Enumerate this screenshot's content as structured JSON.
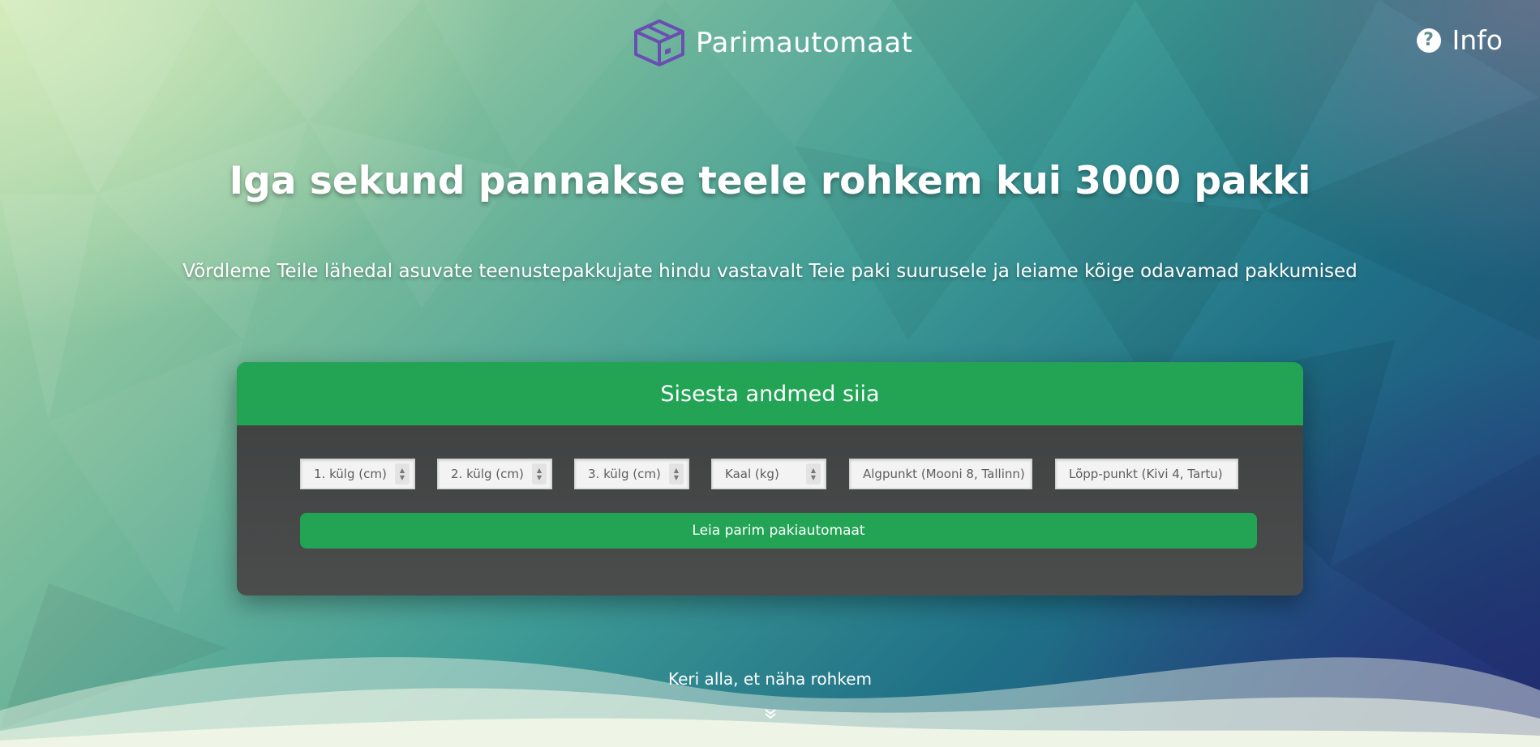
{
  "header": {
    "brand_name": "Parimautomaat",
    "logo_icon": "package-box-icon",
    "info_label": "Info",
    "info_icon": "question-circle-icon"
  },
  "hero": {
    "headline": "Iga sekund pannakse teele rohkem kui 3000 pakki",
    "subline": "Võrdleme Teile lähedal asuvate teenustepakkujate hindu vastavalt Teie paki suurusele ja leiame kõige odavamad pakkumised"
  },
  "form": {
    "title": "Sisesta andmed siia",
    "fields": {
      "side1_placeholder": "1. külg (cm)",
      "side2_placeholder": "2. külg (cm)",
      "side3_placeholder": "3. külg (cm)",
      "weight_placeholder": "Kaal (kg)",
      "origin_placeholder": "Algpunkt (Mooni 8, Tallinn)",
      "destination_placeholder": "Lõpp-punkt (Kivi 4, Tartu)"
    },
    "submit_label": "Leia parim pakiautomaat"
  },
  "footer": {
    "scroll_hint": "Keri alla, et näha rohkem",
    "scroll_icon": "double-chevron-down-icon"
  },
  "colors": {
    "accent_green": "#23a455",
    "card_dark": "#3f4241",
    "logo_purple": "#6a4fb3"
  }
}
